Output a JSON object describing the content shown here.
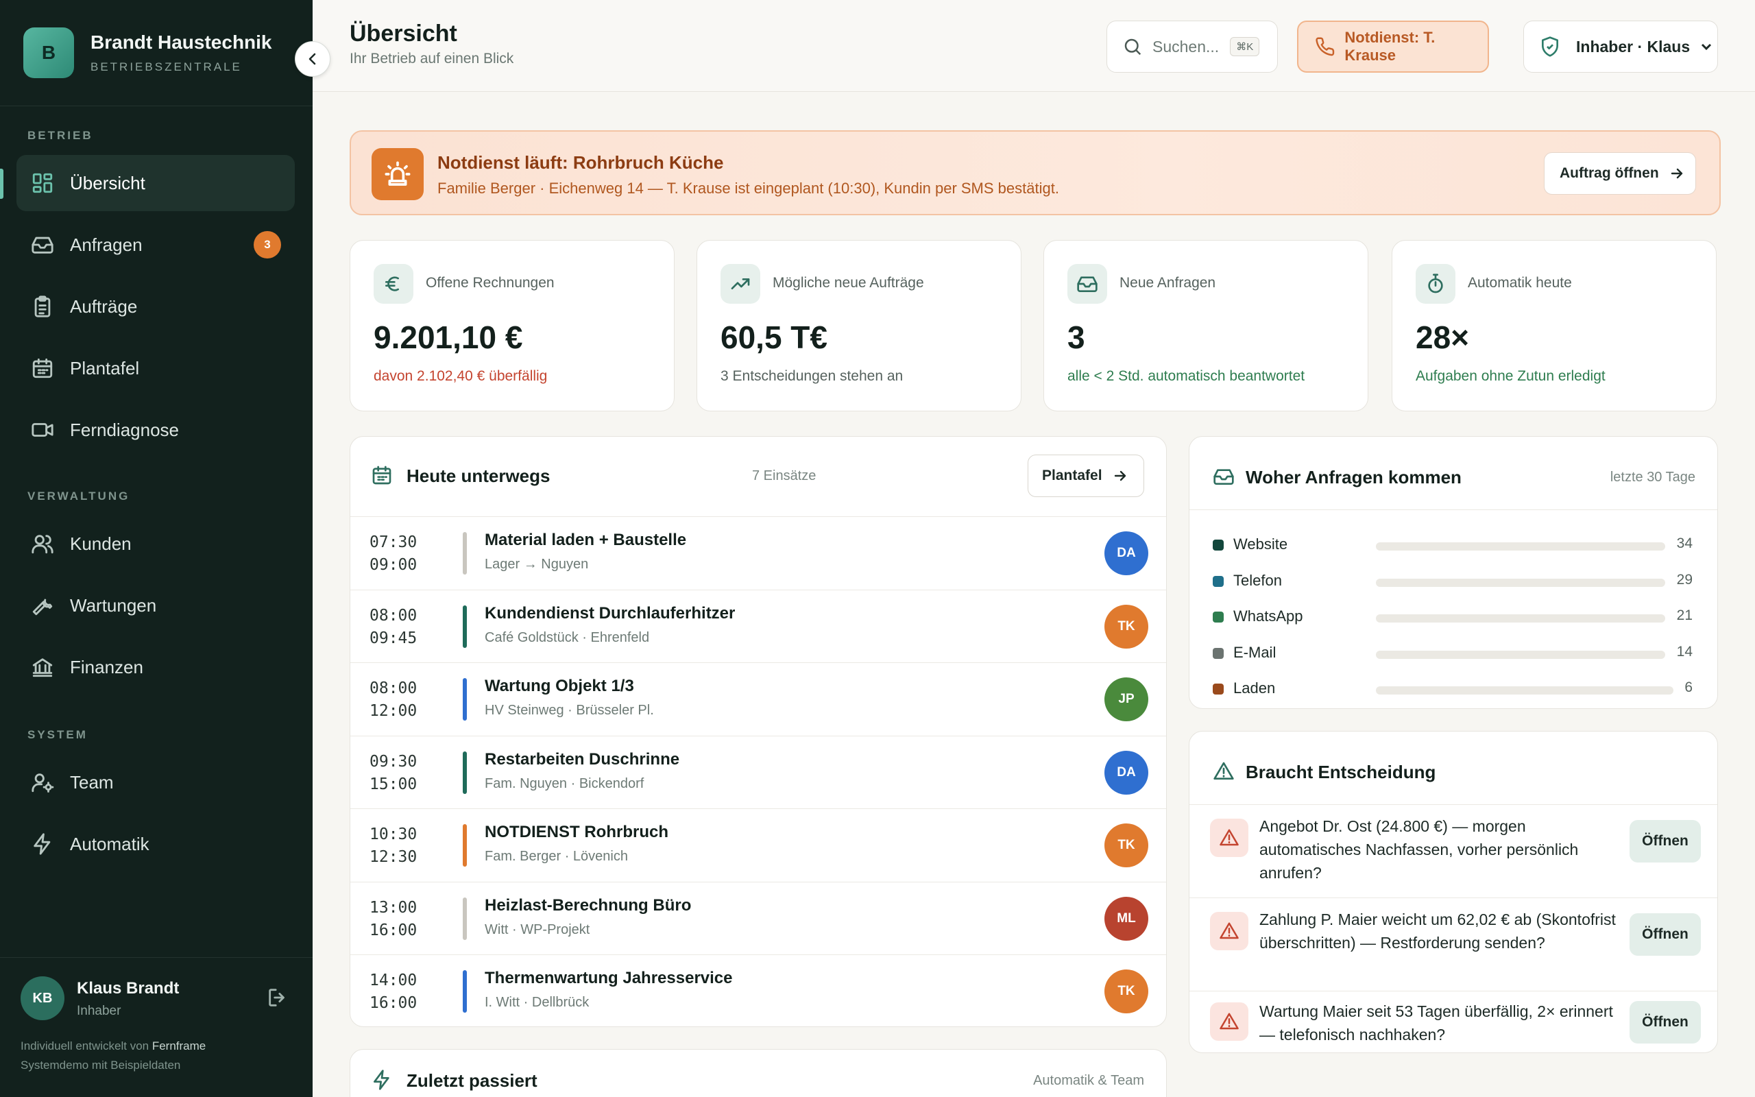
{
  "sidebar": {
    "brand_initial": "B",
    "brand_name": "Brandt Haustechnik",
    "brand_sub": "BETRIEBSZENTRALE",
    "sections": [
      "BETRIEB",
      "VERWALTUNG",
      "SYSTEM"
    ],
    "items": [
      {
        "label": "Übersicht",
        "icon": "dashboard-icon",
        "active": true
      },
      {
        "label": "Anfragen",
        "icon": "inbox-icon",
        "badge": "3"
      },
      {
        "label": "Aufträge",
        "icon": "clipboard-icon"
      },
      {
        "label": "Plantafel",
        "icon": "calendar-icon"
      },
      {
        "label": "Ferndiagnose",
        "icon": "video-icon"
      },
      {
        "label": "Kunden",
        "icon": "users-icon"
      },
      {
        "label": "Wartungen",
        "icon": "wrench-icon"
      },
      {
        "label": "Finanzen",
        "icon": "bank-icon"
      },
      {
        "label": "Team",
        "icon": "user-cog-icon"
      },
      {
        "label": "Automatik",
        "icon": "lightning-icon"
      }
    ],
    "user": {
      "initials": "KB",
      "name": "Klaus Brandt",
      "role": "Inhaber"
    },
    "footer_prefix": "Individuell entwickelt von",
    "footer_brand": "Fernframe",
    "footer_note": "Systemdemo mit Beispieldaten"
  },
  "header": {
    "title": "Übersicht",
    "subtitle": "Ihr Betrieb auf einen Blick",
    "search_placeholder": "Suchen...",
    "search_shortcut": "⌘K",
    "emergency_label": "Notdienst: T. Krause",
    "role_label": "Inhaber · Klaus"
  },
  "alert": {
    "title": "Notdienst läuft: Rohrbruch Küche",
    "text": "Familie Berger · Eichenweg 14 — T. Krause ist eingeplant (10:30), Kundin per SMS bestätigt.",
    "button": "Auftrag öffnen"
  },
  "kpis": [
    {
      "label": "Offene Rechnungen",
      "value": "9.201,10 €",
      "sub": "davon 2.102,40 € überfällig",
      "sub_color": "#c4442f",
      "icon": "euro-icon"
    },
    {
      "label": "Mögliche neue Aufträge",
      "value": "60,5 T€",
      "sub": "3 Entscheidungen stehen an",
      "sub_color": "#56625e",
      "icon": "trending-up-icon"
    },
    {
      "label": "Neue Anfragen",
      "value": "3",
      "sub": "alle < 2 Std. automatisch beantwortet",
      "sub_color": "#2e7d4f",
      "icon": "inbox-icon"
    },
    {
      "label": "Automatik heute",
      "value": "28×",
      "sub": "Aufgaben ohne Zutun erledigt",
      "sub_color": "#2e7d4f",
      "icon": "stopwatch-icon"
    }
  ],
  "schedule": {
    "title": "Heute unterwegs",
    "count": "7 Einsätze",
    "button": "Plantafel",
    "rows": [
      {
        "start": "07:30",
        "end": "09:00",
        "title": "Material laden + Baustelle",
        "sub": "Lager → Nguyen",
        "bar": "#c9c6bf",
        "avatar": "DA",
        "avatar_color": "#2f6fd0"
      },
      {
        "start": "08:00",
        "end": "09:45",
        "title": "Kundendienst Durchlauferhitzer",
        "sub": "Café Goldstück · Ehrenfeld",
        "bar": "#1f6b5a",
        "avatar": "TK",
        "avatar_color": "#e07a2e"
      },
      {
        "start": "08:00",
        "end": "12:00",
        "title": "Wartung Objekt 1/3",
        "sub": "HV Steinweg · Brüsseler Pl.",
        "bar": "#2f6fd0",
        "avatar": "JP",
        "avatar_color": "#4a8a3c"
      },
      {
        "start": "09:30",
        "end": "15:00",
        "title": "Restarbeiten Duschrinne",
        "sub": "Fam. Nguyen · Bickendorf",
        "bar": "#1f6b5a",
        "avatar": "DA",
        "avatar_color": "#2f6fd0"
      },
      {
        "start": "10:30",
        "end": "12:30",
        "title": "NOTDIENST Rohrbruch",
        "sub": "Fam. Berger · Lövenich",
        "bar": "#e07a2e",
        "avatar": "TK",
        "avatar_color": "#e07a2e"
      },
      {
        "start": "13:00",
        "end": "16:00",
        "title": "Heizlast-Berechnung Büro",
        "sub": "Witt · WP-Projekt",
        "bar": "#c9c6bf",
        "avatar": "ML",
        "avatar_color": "#b8432f"
      },
      {
        "start": "14:00",
        "end": "16:00",
        "title": "Thermenwartung Jahresservice",
        "sub": "I. Witt · Dellbrück",
        "bar": "#2f6fd0",
        "avatar": "TK",
        "avatar_color": "#e07a2e"
      }
    ]
  },
  "sources": {
    "title": "Woher Anfragen kommen",
    "period": "letzte 30 Tage",
    "items": [
      {
        "label": "Website",
        "value": "34",
        "color": "#13473c"
      },
      {
        "label": "Telefon",
        "value": "29",
        "color": "#1f6f8a"
      },
      {
        "label": "WhatsApp",
        "value": "21",
        "color": "#2e7d4f"
      },
      {
        "label": "E-Mail",
        "value": "14",
        "color": "#6b7370"
      },
      {
        "label": "Laden",
        "value": "6",
        "color": "#9a4a1c"
      }
    ]
  },
  "decisions": {
    "title": "Braucht Entscheidung",
    "button": "Öffnen",
    "items": [
      {
        "text": "Angebot Dr. Ost (24.800 €) — morgen automatisches Nachfassen, vorher persönlich anrufen?"
      },
      {
        "text": "Zahlung P. Maier weicht um 62,02 € ab (Skontofrist überschritten) — Restforderung senden?"
      },
      {
        "text": "Wartung Maier seit 53 Tagen überfällig, 2× erinnert — telefonisch nachhaken?"
      }
    ]
  },
  "recent": {
    "title": "Zuletzt passiert",
    "meta": "Automatik & Team"
  }
}
